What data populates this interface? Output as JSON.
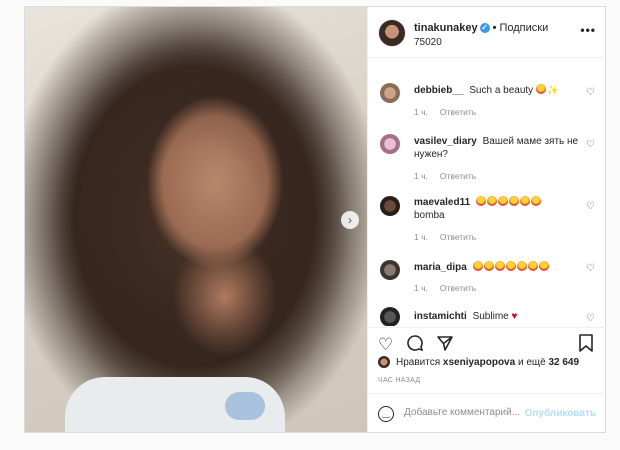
{
  "post": {
    "author": "tinakunakey",
    "follow_label": "Подписки",
    "subtitle": "75020",
    "menu_label": "•••",
    "next_arrow": "›"
  },
  "comments": [
    {
      "user": "debbieb__",
      "text": "Such a beauty",
      "emoji": [
        "smiling-face-with-heart-eyes",
        "sparkles"
      ],
      "time": "1 ч.",
      "reply": "Ответить"
    },
    {
      "user": "vasilev_diary",
      "text": "Вашей маме зять не нужен?",
      "emoji": [],
      "time": "1 ч.",
      "reply": "Ответить"
    },
    {
      "user": "maevaled11",
      "text": "bomba",
      "emoji": [
        "smiling-face-with-heart-eyes",
        "smiling-face-with-heart-eyes",
        "smiling-face-with-heart-eyes",
        "smiling-face-with-heart-eyes",
        "smiling-face-with-heart-eyes",
        "smiling-face-with-heart-eyes"
      ],
      "time": "1 ч.",
      "reply": "Ответить"
    },
    {
      "user": "maria_dipa",
      "text": "",
      "emoji": [
        "smiling-face-with-heart-eyes",
        "smiling-face-with-heart-eyes",
        "smiling-face-with-heart-eyes",
        "smiling-face-with-heart-eyes",
        "smiling-face-with-heart-eyes",
        "smiling-face-with-heart-eyes",
        "smiling-face-with-heart-eyes"
      ],
      "time": "1 ч.",
      "reply": "Ответить"
    },
    {
      "user": "instamichti",
      "text": "Sublime",
      "emoji": [
        "red-heart"
      ],
      "time": "",
      "reply": ""
    }
  ],
  "likes": {
    "prefix": "Нравится",
    "user": "xseniyapopova",
    "connector": "и ещё",
    "count": "32 649"
  },
  "time_ago": "ЧАС НАЗАД",
  "add_comment": {
    "placeholder": "Добавьте комментарий...",
    "publish_label": "Опубликовать"
  },
  "icons": {
    "like": "heart-outline-icon",
    "comment": "comment-bubble-icon",
    "share": "paper-plane-icon",
    "save": "bookmark-icon",
    "emoji": "smiley-face-icon",
    "verified": "verified-badge-icon"
  },
  "colors": {
    "verified": "#3897f0",
    "publish_disabled": "#b2dffc",
    "muted_text": "#8e8e8e",
    "border": "#dbdbdb",
    "heart_red": "#c8102e"
  }
}
